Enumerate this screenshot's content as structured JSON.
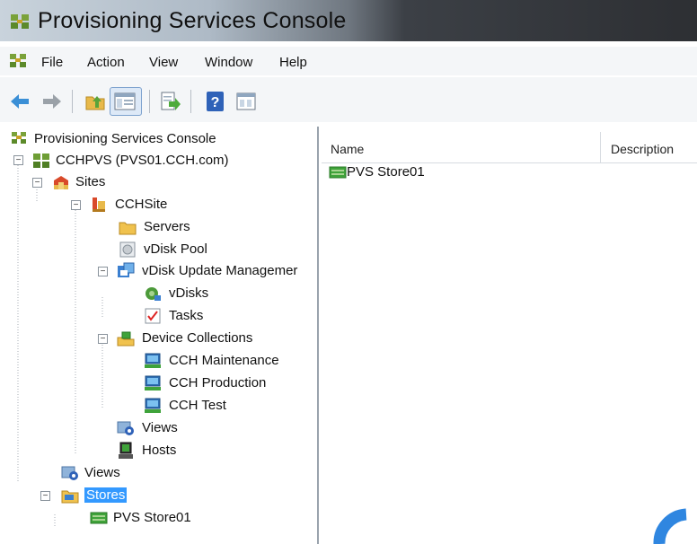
{
  "window": {
    "title": "Provisioning Services Console"
  },
  "menubar": {
    "items": [
      "File",
      "Action",
      "View",
      "Window",
      "Help"
    ]
  },
  "toolbar": {
    "buttons": [
      "back-arrow-icon",
      "forward-arrow-icon",
      "up-folder-icon",
      "show-hide-tree-icon",
      "export-list-icon",
      "help-icon",
      "properties-icon"
    ]
  },
  "tree": {
    "root": "Provisioning Services Console",
    "farm": "CCHPVS (PVS01.CCH.com)",
    "sites": "Sites",
    "site": "CCHSite",
    "servers": "Servers",
    "vdisk_pool": "vDisk Pool",
    "vdisk_update": "vDisk Update Managemer",
    "vdisks": "vDisks",
    "tasks": "Tasks",
    "device_collections": "Device Collections",
    "collections": [
      "CCH Maintenance",
      "CCH Production",
      "CCH Test"
    ],
    "site_views": "Views",
    "hosts": "Hosts",
    "farm_views": "Views",
    "stores": "Stores",
    "store": "PVS Store01"
  },
  "list": {
    "columns": [
      "Name",
      "Description"
    ],
    "rows": [
      {
        "name": "PVS Store01"
      }
    ]
  },
  "colors": {
    "selection": "#3399ff"
  }
}
